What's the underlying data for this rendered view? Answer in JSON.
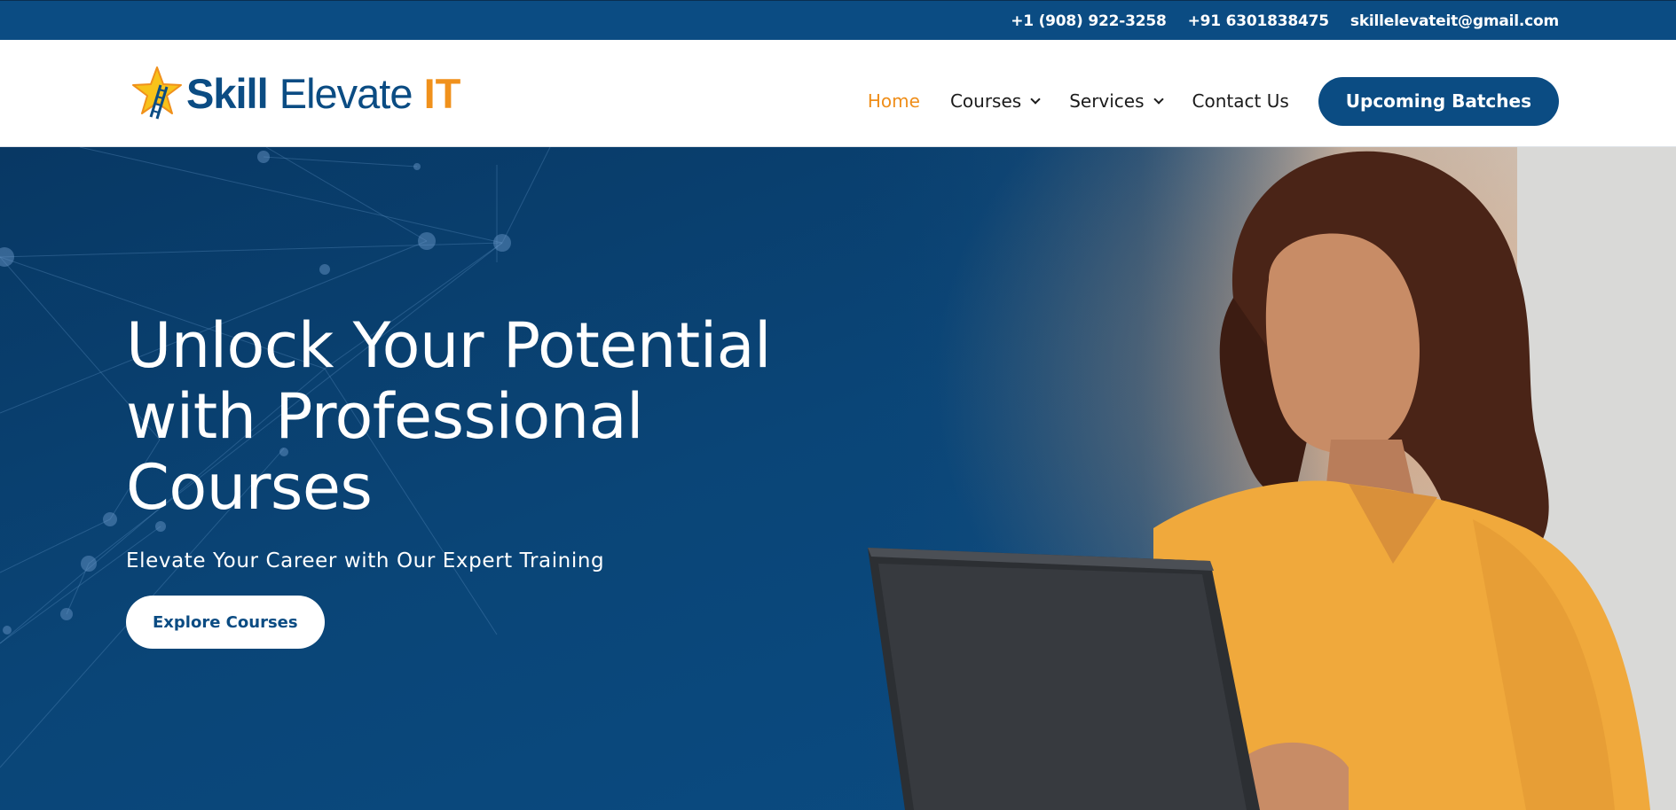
{
  "topbar": {
    "phone_us": "+1 (908) 922-3258",
    "phone_in": "+91 6301838475",
    "email": "skillelevateit@gmail.com"
  },
  "logo": {
    "skill": "Skill",
    "elevate": "Elevate",
    "it": "IT",
    "icon": "star-ladder-icon"
  },
  "nav": {
    "home": "Home",
    "courses": "Courses",
    "services": "Services",
    "contact": "Contact Us",
    "cta": "Upcoming Batches"
  },
  "hero": {
    "title_line1": "Unlock Your Potential",
    "title_line2": "with Professional",
    "title_line3": "Courses",
    "subtitle": "Elevate Your Career with Our Expert Training",
    "button": "Explore Courses"
  },
  "colors": {
    "brand_blue": "#0b4c83",
    "accent_orange": "#ef8e1a",
    "white": "#ffffff"
  }
}
